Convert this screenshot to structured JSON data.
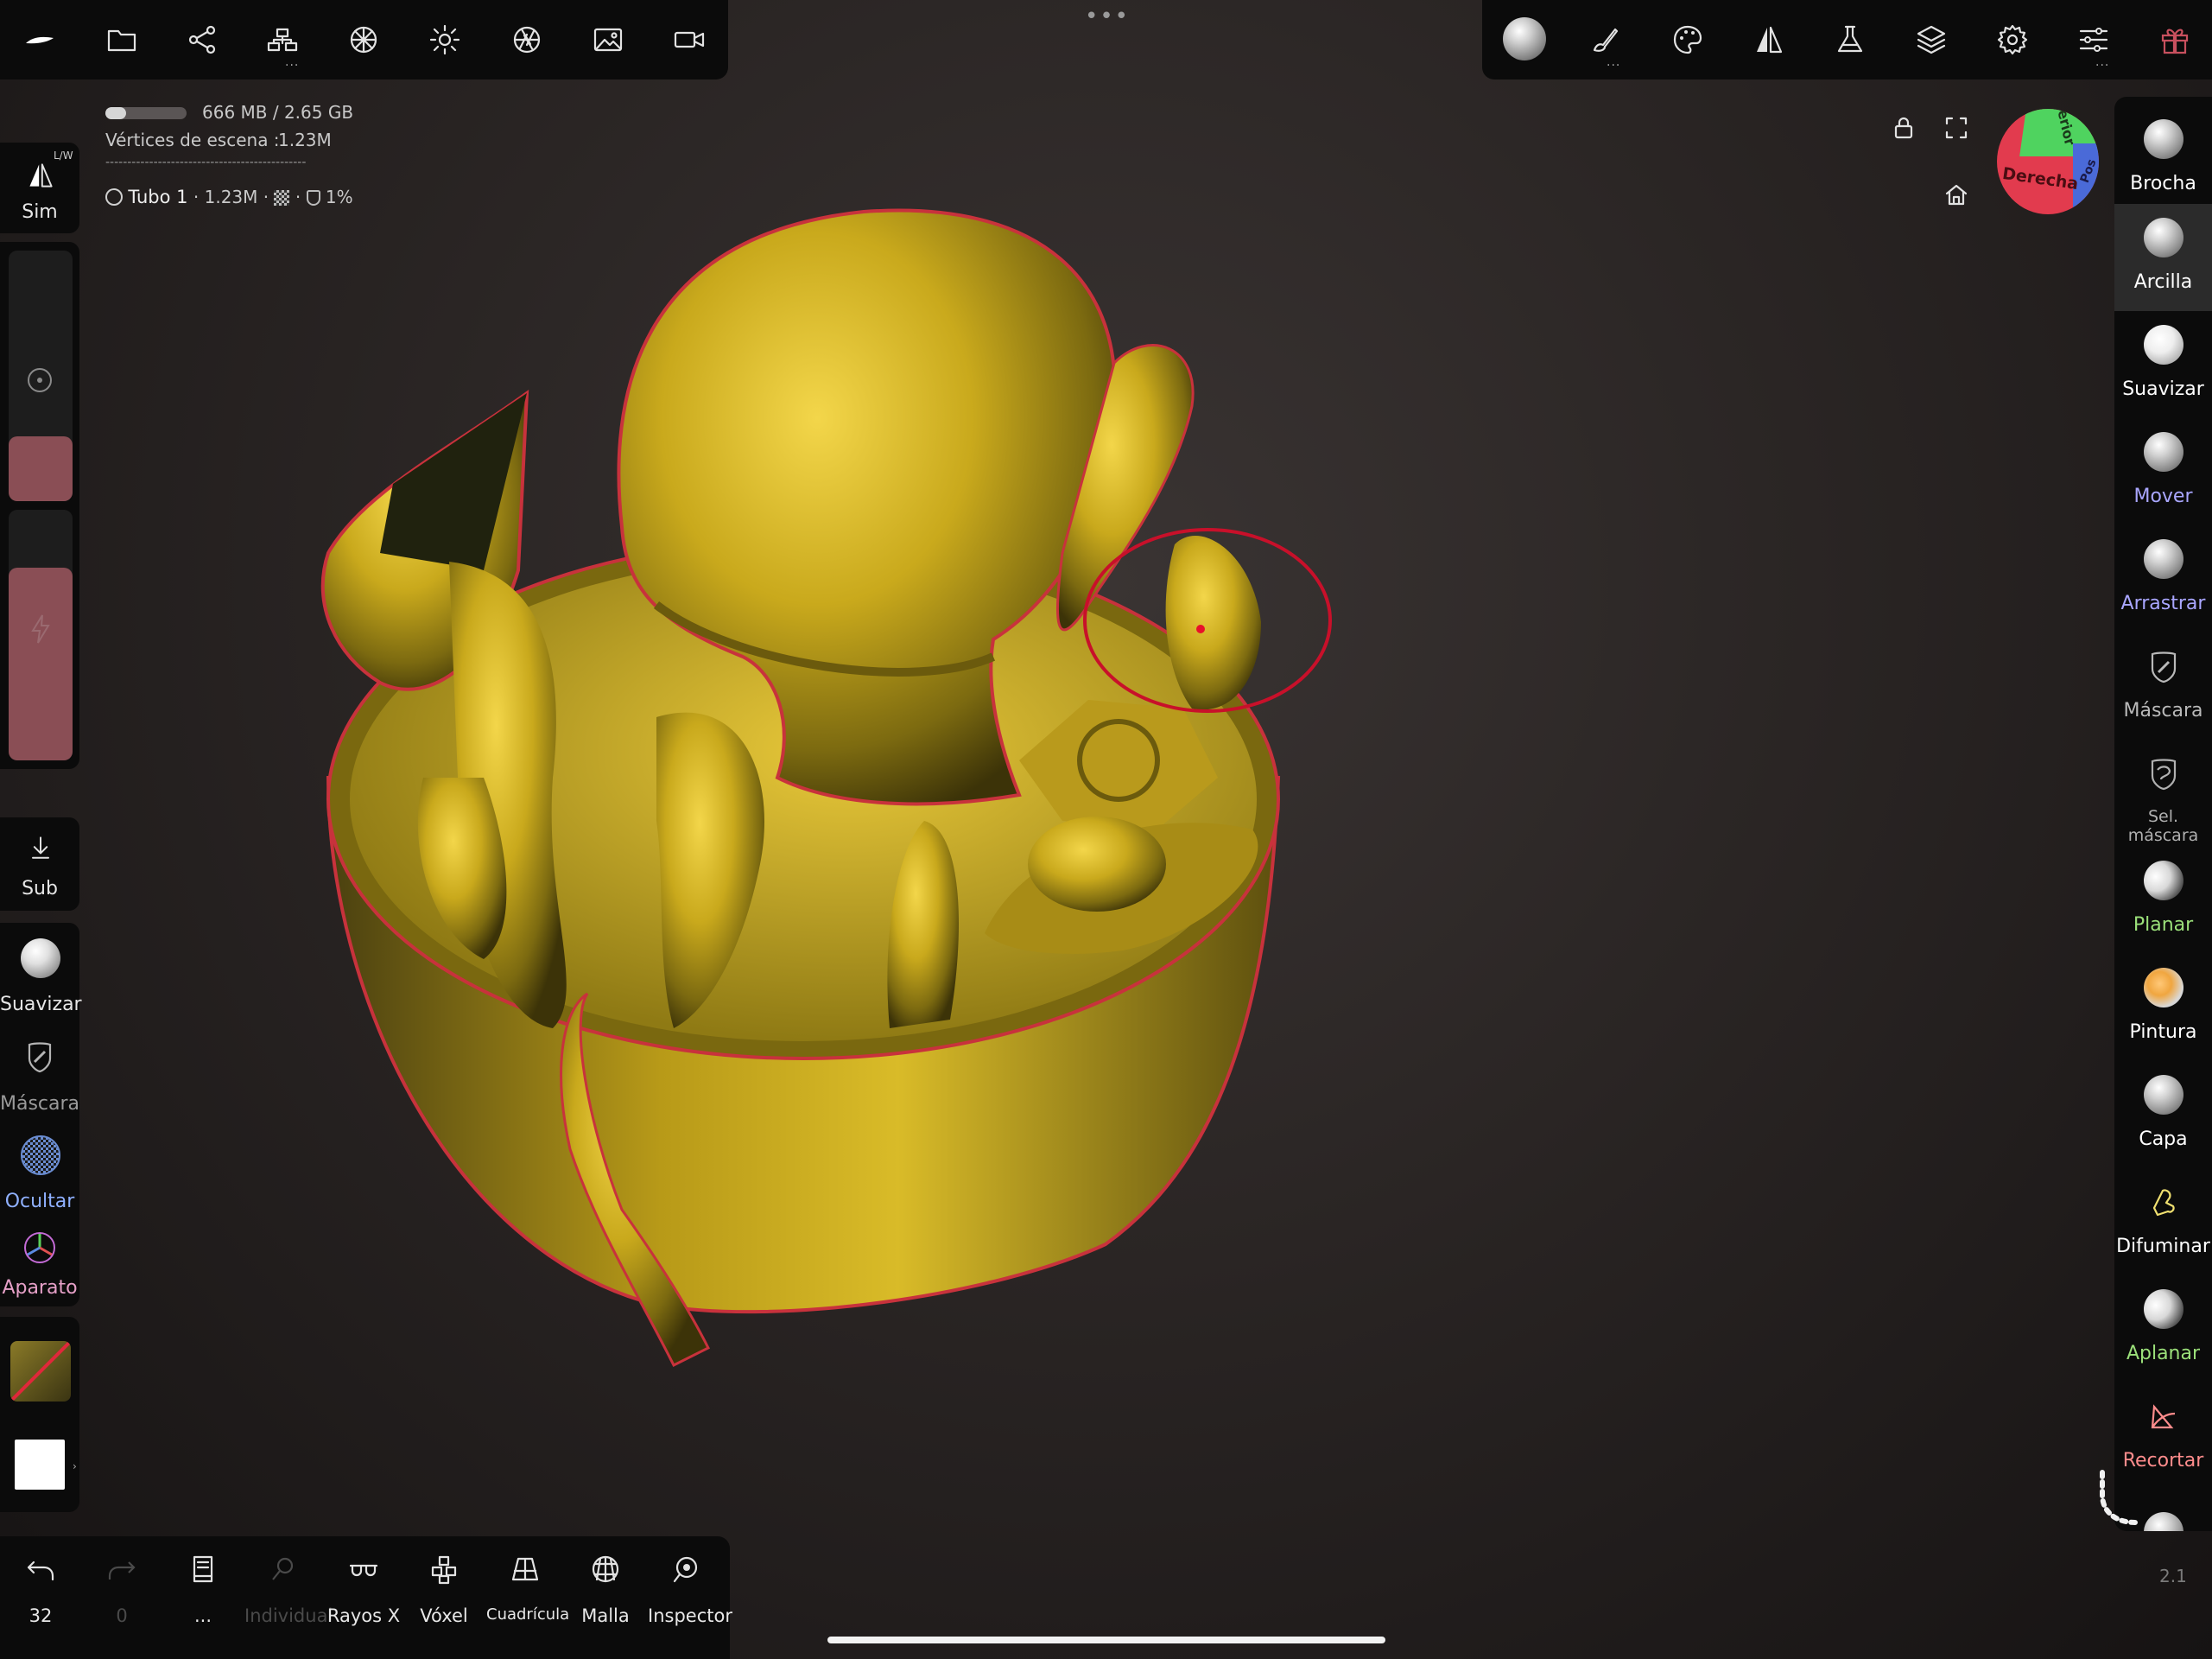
{
  "app": {
    "colors": {
      "accent_red": "#c8323c",
      "mask_color": "#8a4e55",
      "model_gold": "#c9a91c",
      "panel": "#0b0b0b"
    }
  },
  "top_left_toolbar": {
    "icons": [
      "nomad-logo-icon",
      "folder-icon",
      "share-icon",
      "scene-tree-icon",
      "texture-sphere-icon",
      "light-icon",
      "camera-aperture-icon",
      "image-icon",
      "video-icon"
    ]
  },
  "top_center": {
    "more": "•••"
  },
  "top_right_toolbar": {
    "icons": [
      "material-ball-icon",
      "brush-stroke-icon",
      "palette-icon",
      "symmetry-icon",
      "flask-icon",
      "layers-icon",
      "gear-icon",
      "sliders-icon",
      "gift-icon"
    ]
  },
  "stats": {
    "memory": "666 MB / 2.65 GB",
    "memory_fraction": 0.25,
    "vertices_label": "Vértices de escena :",
    "vertices_value": "1.23M",
    "separator": "----------------------------------------------",
    "object_name": "Tubo 1",
    "object_info": "· 1.23M ·",
    "object_extra": "·",
    "object_percent": "1%"
  },
  "left_panel": {
    "sym_label": "Sim",
    "sym_badge": "L/W",
    "sub_label": "Sub",
    "suavizar_label": "Suavizar",
    "mascara_label": "Máscara",
    "ocultar_label": "Ocultar",
    "aparato_label": "Aparato"
  },
  "brushes": [
    {
      "label": "Brocha",
      "color": "#ffffff"
    },
    {
      "label": "Arcilla",
      "color": "#ffffff"
    },
    {
      "label": "Suavizar",
      "color": "#ffffff"
    },
    {
      "label": "Mover",
      "color": "#a9a6ff"
    },
    {
      "label": "Arrastrar",
      "color": "#a9a6ff"
    },
    {
      "label": "Máscara",
      "color": "#b9b9b9"
    },
    {
      "label": "Sel. máscara",
      "color": "#b0b0b0"
    },
    {
      "label": "Planar",
      "color": "#9be07a"
    },
    {
      "label": "Pintura",
      "color": "#ffffff"
    },
    {
      "label": "Capa",
      "color": "#ffffff"
    },
    {
      "label": "Difuminar",
      "color": "#ffffff"
    },
    {
      "label": "Aplanar",
      "color": "#9be07a"
    },
    {
      "label": "Recortar",
      "color": "#ff8c8c"
    }
  ],
  "viewport": {
    "lock_icon": "lock-icon",
    "fullscreen_icon": "fullscreen-icon",
    "home_icon": "home-icon",
    "cube": {
      "right": "Derecha",
      "top": "erior",
      "back": "Pos"
    },
    "version": "2.1"
  },
  "bottom_toolbar": {
    "undo_count": "32",
    "redo_count": "0",
    "more_label": "...",
    "individual_label": "Individual",
    "xray_label": "Rayos X",
    "voxel_label": "Vóxel",
    "grid_label": "Cuadrícula",
    "mesh_label": "Malla",
    "inspector_label": "Inspector"
  }
}
